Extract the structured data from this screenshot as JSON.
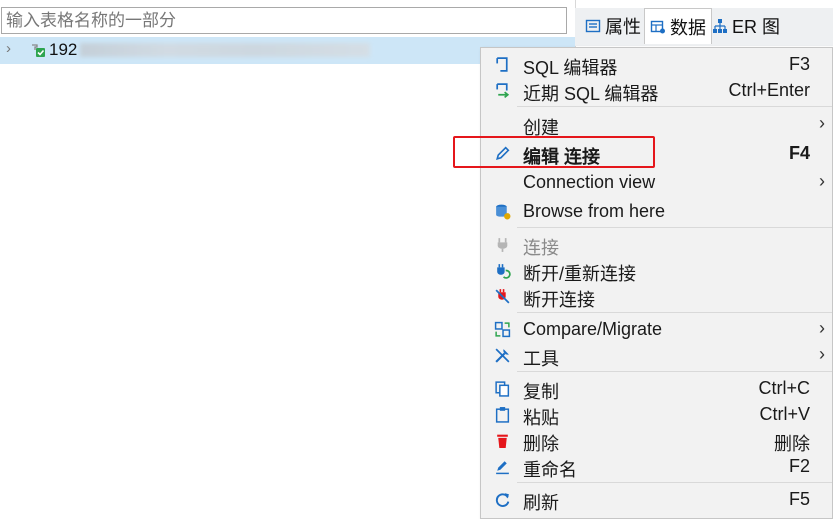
{
  "colors": {
    "accent": "#1e6fc4",
    "selection": "#cde6f7",
    "highlight_border": "#e5161b",
    "menu_bg": "#f2f2f2"
  },
  "search": {
    "placeholder": "输入表格名称的一部分"
  },
  "tree": {
    "node_label": "192",
    "node_icon": "connection-ok-icon"
  },
  "tabs": [
    {
      "label": "属性",
      "icon": "properties-icon"
    },
    {
      "label": "数据",
      "icon": "data-grid-icon"
    },
    {
      "label": "ER 图",
      "icon": "er-diagram-icon"
    }
  ],
  "menu": {
    "items": [
      {
        "label": "SQL 编辑器",
        "shortcut": "F3",
        "icon": "sql-editor-icon"
      },
      {
        "label": "近期 SQL 编辑器",
        "shortcut": "Ctrl+Enter",
        "icon": "recent-sql-editor-icon"
      },
      {
        "label": "创建",
        "shortcut": "",
        "icon": "",
        "submenu": "›"
      },
      {
        "label": "编辑 连接",
        "shortcut": "F4",
        "icon": "pencil-icon"
      },
      {
        "label": "Connection view",
        "shortcut": "",
        "icon": "",
        "submenu": "›"
      },
      {
        "label": "Browse from here",
        "shortcut": "",
        "icon": "database-browse-icon"
      },
      {
        "label": "连接",
        "shortcut": "",
        "icon": "plug-icon"
      },
      {
        "label": "断开/重新连接",
        "shortcut": "",
        "icon": "reconnect-icon"
      },
      {
        "label": "断开连接",
        "shortcut": "",
        "icon": "disconnect-icon"
      },
      {
        "label": "Compare/Migrate",
        "shortcut": "",
        "icon": "compare-icon",
        "submenu": "›"
      },
      {
        "label": "工具",
        "shortcut": "",
        "icon": "tools-icon",
        "submenu": "›"
      },
      {
        "label": "复制",
        "shortcut": "Ctrl+C",
        "icon": "copy-icon"
      },
      {
        "label": "粘贴",
        "shortcut": "Ctrl+V",
        "icon": "paste-icon"
      },
      {
        "label": "删除",
        "shortcut": "删除",
        "icon": "delete-icon"
      },
      {
        "label": "重命名",
        "shortcut": "F2",
        "icon": "rename-icon"
      },
      {
        "label": "刷新",
        "shortcut": "F5",
        "icon": "refresh-icon"
      }
    ]
  }
}
